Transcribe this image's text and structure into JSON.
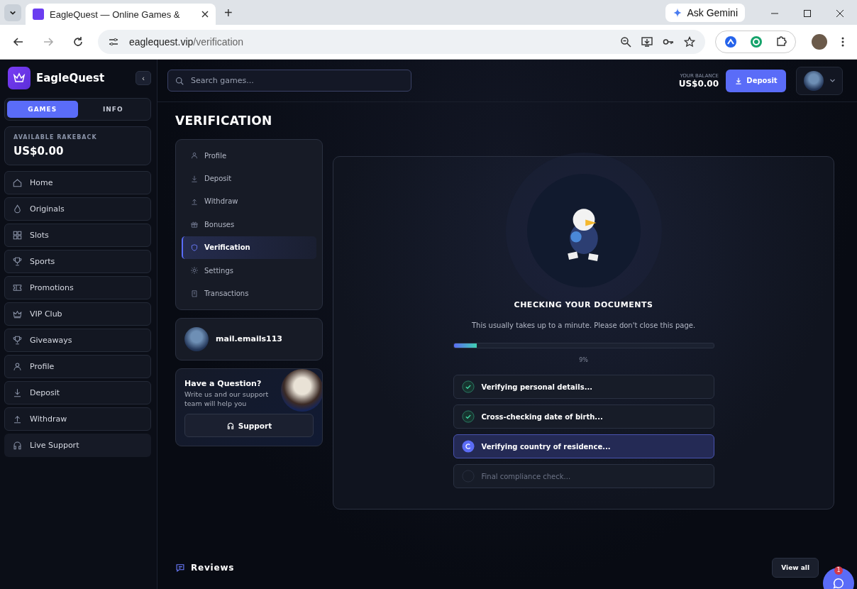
{
  "browser": {
    "tab_title": "EagleQuest — Online Games &",
    "new_tab": "+",
    "ask_gemini": "Ask Gemini",
    "address": {
      "host": "eaglequest.vip",
      "path": "/verification"
    }
  },
  "sidebar": {
    "brand": "EagleQuest",
    "collapse": "‹",
    "tabs": [
      {
        "label": "GAMES",
        "selected": true
      },
      {
        "label": "INFO",
        "selected": false
      }
    ],
    "rakeback": {
      "label": "AVAILABLE RAKEBACK",
      "amount": "US$0.00"
    },
    "items": [
      {
        "label": "Home",
        "kind": "page"
      },
      {
        "label": "Originals",
        "kind": "page"
      },
      {
        "label": "Slots",
        "kind": "page"
      },
      {
        "label": "Sports",
        "kind": "page"
      },
      {
        "label": "Promotions",
        "kind": "page"
      },
      {
        "label": "VIP Club",
        "kind": "page"
      },
      {
        "label": "Giveaways",
        "kind": "page"
      },
      {
        "label": "Profile",
        "kind": "page"
      },
      {
        "label": "Deposit",
        "kind": "page"
      },
      {
        "label": "Withdraw",
        "kind": "page"
      },
      {
        "label": "Live Support",
        "kind": "support"
      }
    ]
  },
  "header": {
    "search": {
      "placeholder": "Search games..."
    },
    "balance_label": "YOUR BALANCE",
    "balance": "US$0.00",
    "deposit": "Deposit"
  },
  "page_title": "VERIFICATION",
  "account_menu": [
    {
      "label": "Profile",
      "selected": false
    },
    {
      "label": "Deposit",
      "selected": false
    },
    {
      "label": "Withdraw",
      "selected": false
    },
    {
      "label": "Bonuses",
      "selected": false
    },
    {
      "label": "Verification",
      "selected": true
    },
    {
      "label": "Settings",
      "selected": false
    },
    {
      "label": "Transactions",
      "selected": false
    }
  ],
  "user": {
    "name": "mail.emails113"
  },
  "help": {
    "title": "Have a Question?",
    "text": "Write us and our support team will help you",
    "button": "Support"
  },
  "check": {
    "title": "CHECKING YOUR DOCUMENTS",
    "subtitle": "This usually takes up to a minute. Please don't close this page.",
    "level": 0.09,
    "percent": "9%",
    "steps": [
      {
        "label": "Verifying personal details...",
        "kind": "done"
      },
      {
        "label": "Cross-checking date of birth...",
        "kind": "done"
      },
      {
        "label": "Verifying country of residence...",
        "kind": "active"
      },
      {
        "label": "Final compliance check...",
        "kind": "pending"
      }
    ]
  },
  "reviews": {
    "title": "Reviews",
    "view_all": "View all"
  },
  "chat": {
    "badge": "1"
  }
}
